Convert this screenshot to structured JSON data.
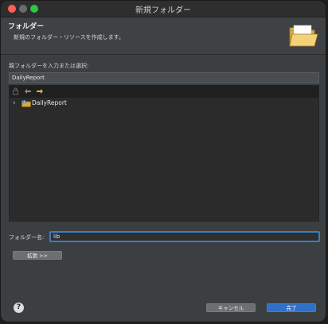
{
  "window": {
    "title": "新規フォルダー"
  },
  "header": {
    "title": "フォルダー",
    "description": "新規のフォルダー・リソースを作成します。",
    "icon": "open-folder-icon"
  },
  "parent": {
    "label": "親フォルダーを入力または選択:",
    "value": "DailyReport"
  },
  "tree": {
    "toolbar_icons": [
      "collapse-all-icon",
      "back-arrow-icon",
      "forward-arrow-icon"
    ],
    "items": [
      {
        "label": "DailyReport",
        "icon": "java-project-icon",
        "expanded": false
      }
    ]
  },
  "folder_name": {
    "label": "フォルダー名:",
    "value": "lib"
  },
  "buttons": {
    "advanced": "拡張 >>",
    "cancel": "キャンセル",
    "finish": "完了"
  },
  "colors": {
    "accent": "#2f71c9",
    "focus_ring": "#3d7cc4",
    "forward_arrow": "#f0b429"
  }
}
